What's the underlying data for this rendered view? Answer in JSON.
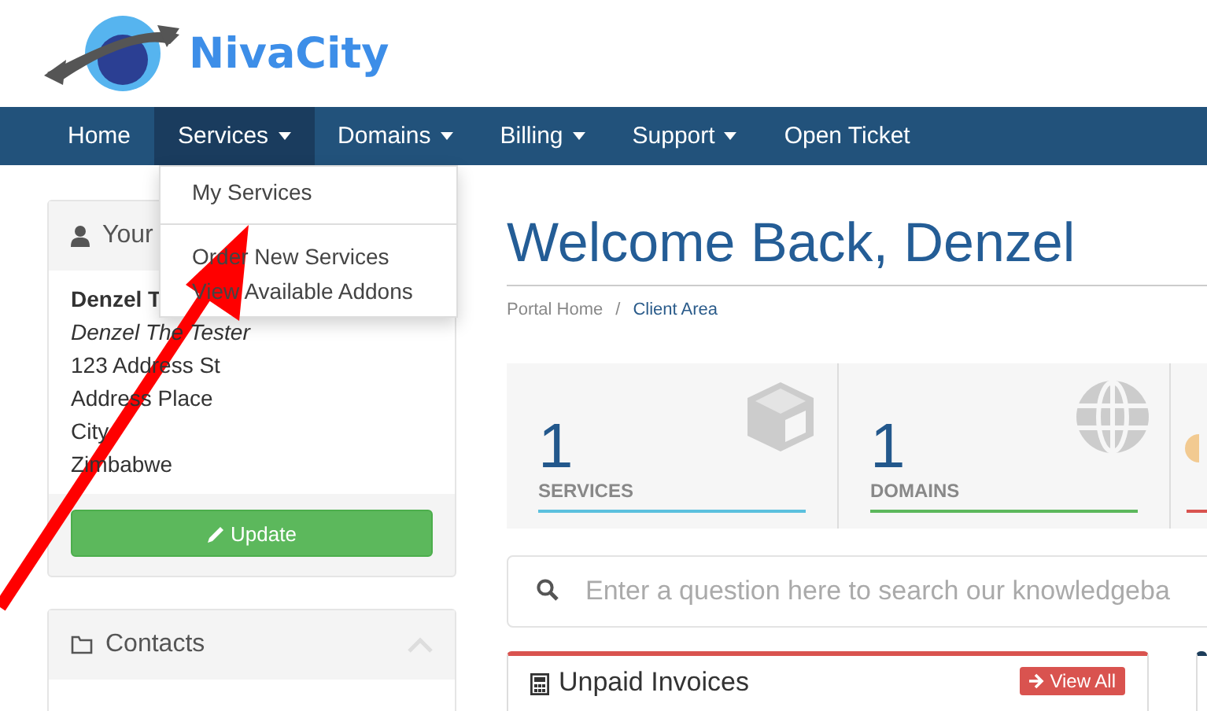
{
  "logo": {
    "text": "NivaCity"
  },
  "nav": [
    {
      "label": "Home",
      "dropdown": false,
      "selected": false
    },
    {
      "label": "Services",
      "dropdown": true,
      "selected": true
    },
    {
      "label": "Domains",
      "dropdown": true,
      "selected": false
    },
    {
      "label": "Billing",
      "dropdown": true,
      "selected": false
    },
    {
      "label": "Support",
      "dropdown": true,
      "selected": false
    },
    {
      "label": "Open Ticket",
      "dropdown": false,
      "selected": false
    }
  ],
  "dropdown": {
    "groups": [
      [
        "My Services"
      ],
      [
        "Order New Services",
        "View Available Addons"
      ]
    ]
  },
  "info_panel": {
    "title": "Your",
    "name": "Denzel T",
    "lines": [
      {
        "text": "Denzel The Tester",
        "kind": "italic"
      },
      {
        "text": "123 Address St",
        "kind": "plain"
      },
      {
        "text": "Address Place",
        "kind": "plain"
      },
      {
        "text": "City",
        "kind": "plain"
      },
      {
        "text": "Zimbabwe",
        "kind": "plain"
      }
    ],
    "button": "Update"
  },
  "contacts_panel": {
    "title": "Contacts",
    "expanded": true
  },
  "heading": "Welcome Back, Denzel",
  "breadcrumb": {
    "separator": "/",
    "items": [
      {
        "label": "Portal Home",
        "selected": false
      },
      {
        "label": "Client Area",
        "selected": true
      }
    ]
  },
  "stats": [
    {
      "kind": "services",
      "count": "1",
      "label": "SERVICES",
      "color": "#5bc0de"
    },
    {
      "kind": "domains",
      "count": "1",
      "label": "DOMAINS",
      "color": "#5cb85c"
    },
    {
      "kind": "tickets",
      "color": "#d9534f"
    }
  ],
  "search": {
    "placeholder": "Enter a question here to search our knowledgeba"
  },
  "invoices": {
    "title": "Unpaid Invoices",
    "button": "View All"
  }
}
